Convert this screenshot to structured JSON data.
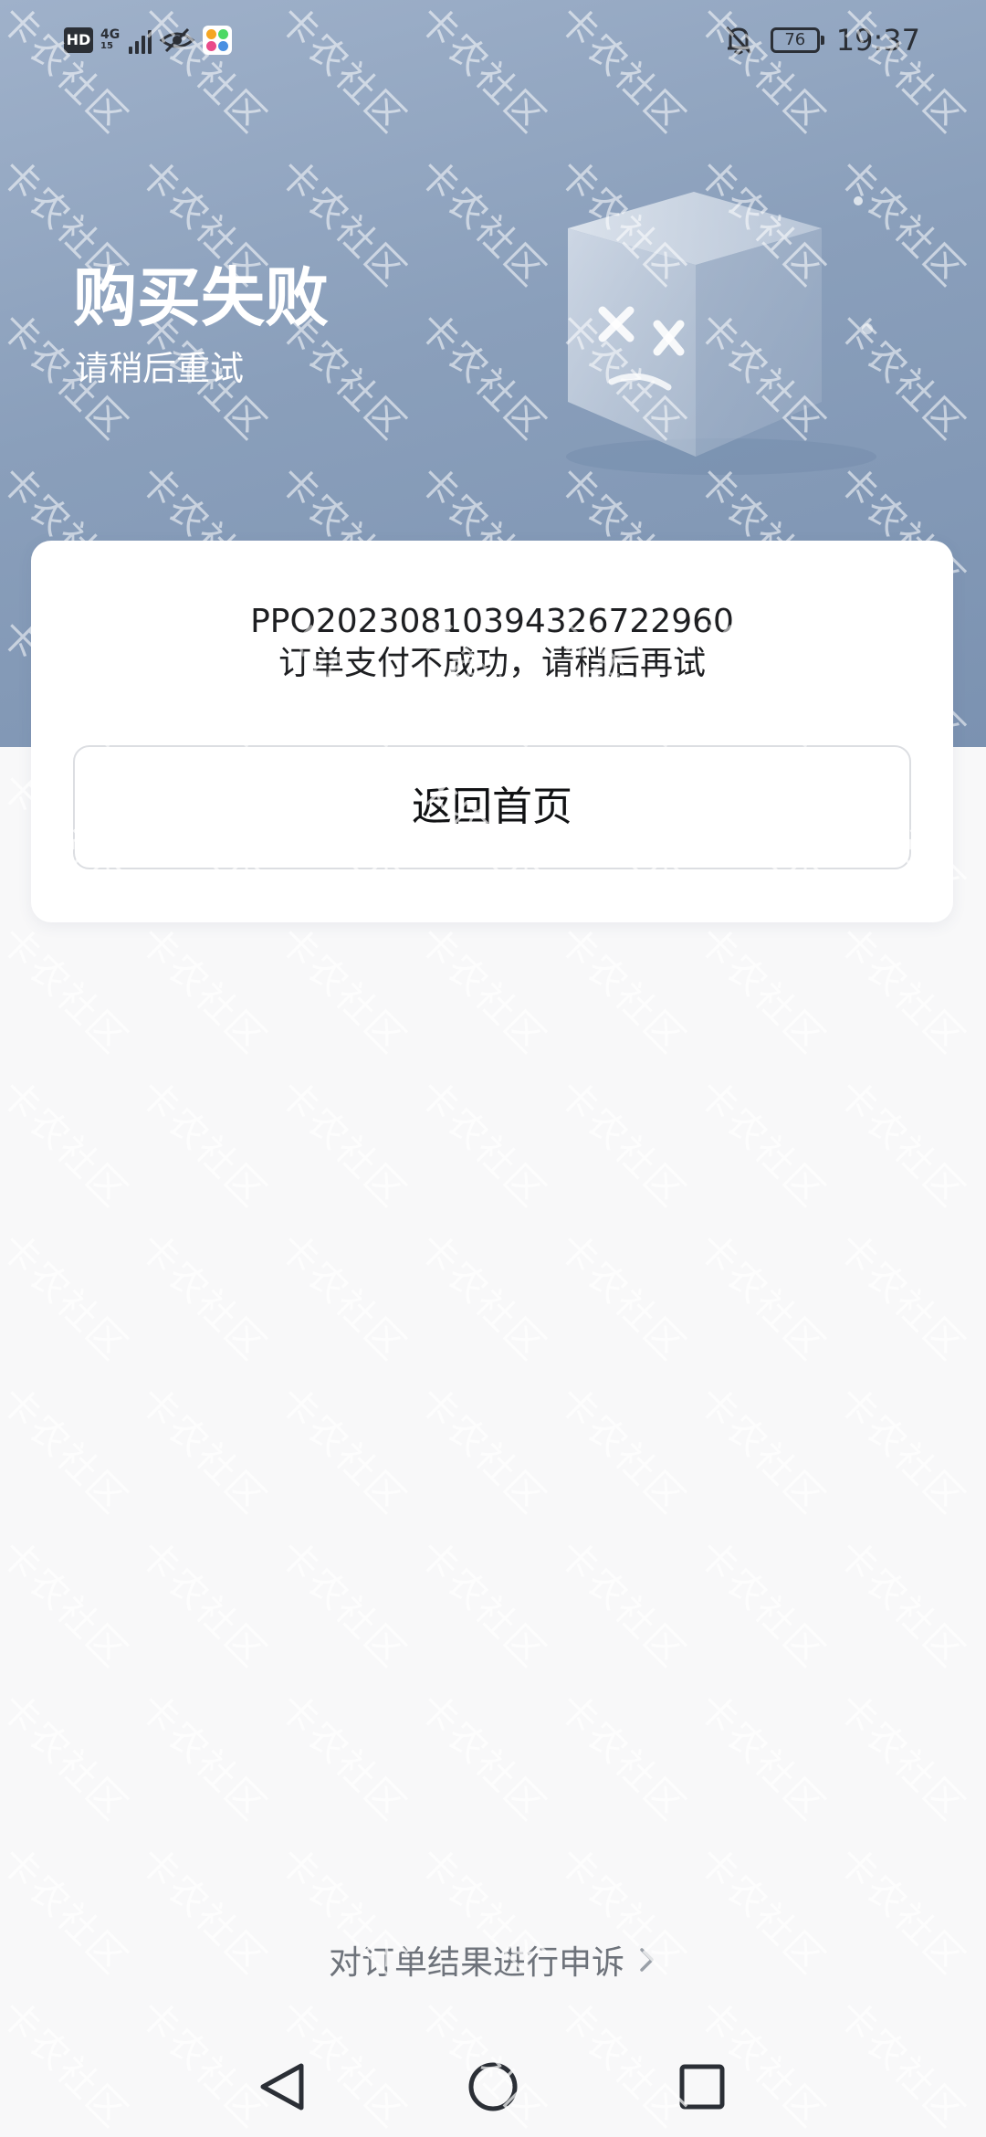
{
  "status_bar": {
    "hd": "HD",
    "network": "4G",
    "network_sub": "15",
    "battery": "76",
    "time": "19:37",
    "icons": [
      "hd-icon",
      "signal-icon",
      "eye-off-icon",
      "app-icon",
      "bell-off-icon",
      "battery-icon"
    ]
  },
  "header": {
    "title": "购买失败",
    "subtitle": "请稍后重试",
    "illustration": "broken-cube-icon"
  },
  "order": {
    "id": "PPO20230810394326722960",
    "message": "订单支付不成功，请稍后再试"
  },
  "buttons": {
    "home": "返回首页"
  },
  "appeal": {
    "label": "对订单结果进行申诉",
    "icon": "chevron-right-icon"
  },
  "watermark": {
    "text": "卡农社区"
  },
  "colors": {
    "header_bg": "#8a9fbb",
    "page_bg": "#f8f8f9",
    "card_bg": "#ffffff",
    "appeal_text": "#6e737b"
  },
  "nav": {
    "icons": [
      "back-triangle-icon",
      "home-circle-icon",
      "recents-square-icon"
    ]
  }
}
